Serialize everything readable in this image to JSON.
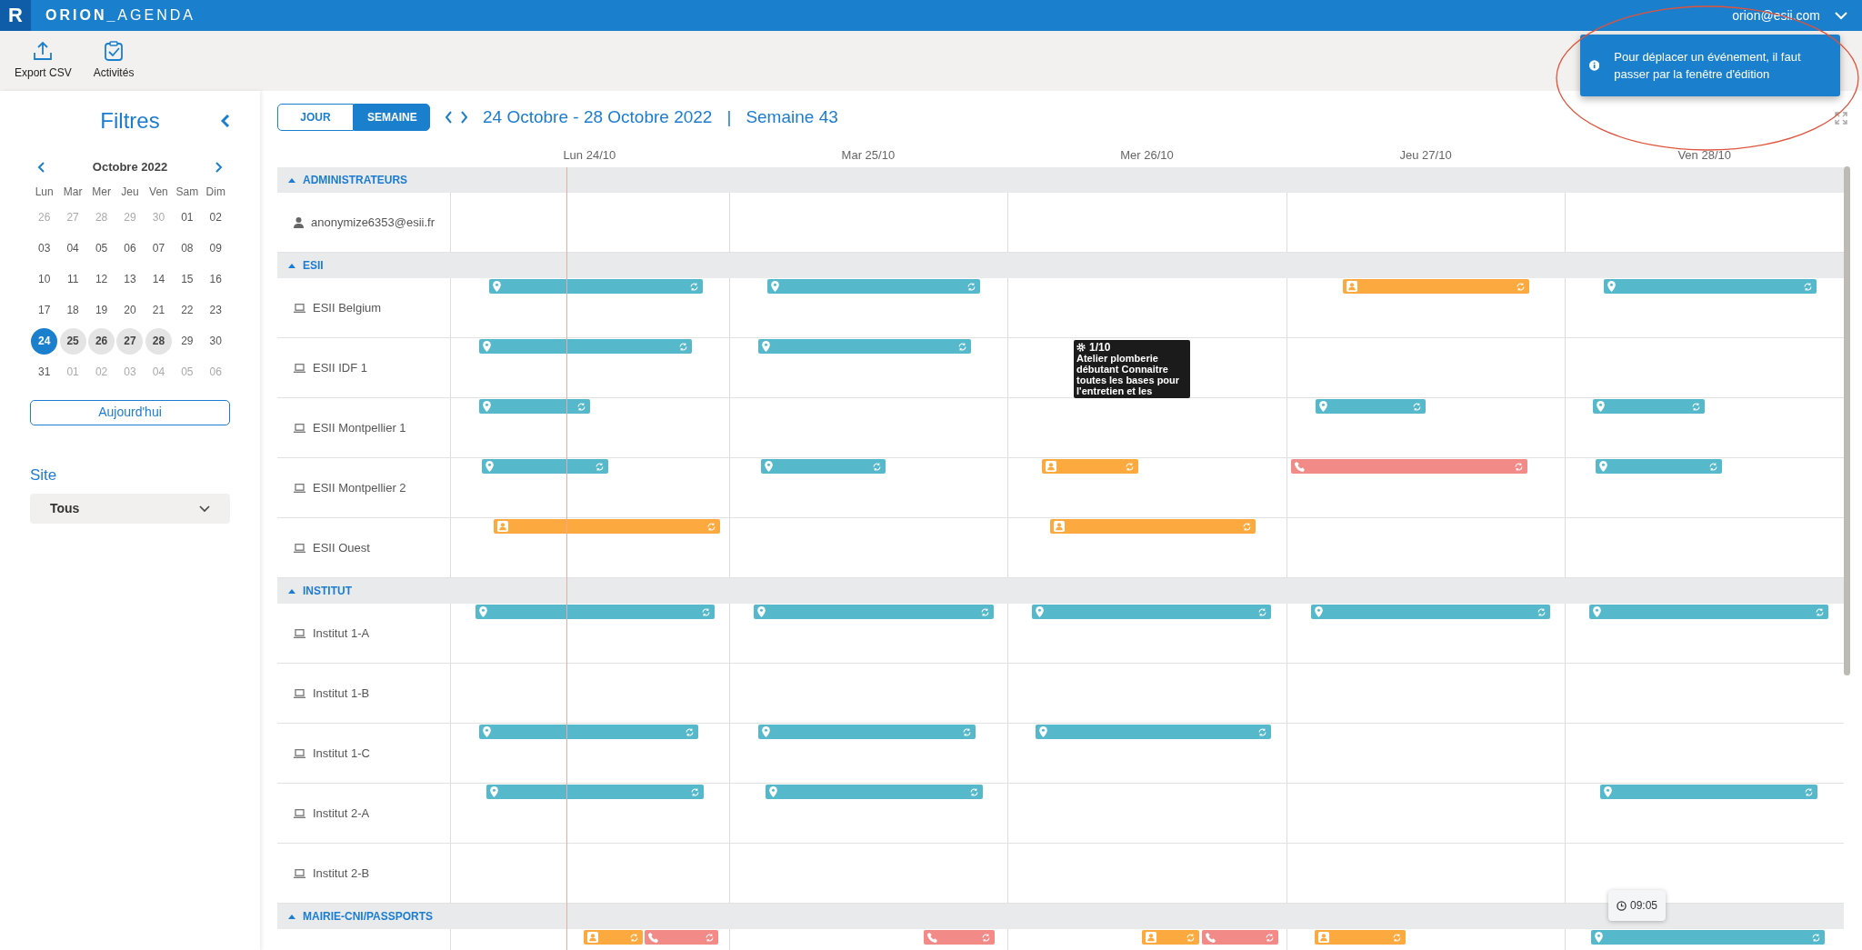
{
  "app": {
    "logo": "R",
    "title": "**ORION_**AGENDA",
    "user": "orion@esii.com"
  },
  "toolbar": [
    {
      "label": "Export CSV",
      "kind": "export"
    },
    {
      "label": "Activités",
      "kind": "activities"
    }
  ],
  "notification": {
    "text": "Pour déplacer un événement, il faut passer par la fenêtre d'édition"
  },
  "filters": {
    "title": "Filtres",
    "calendar": {
      "month": "Octobre 2022",
      "weekdays": [
        "Lun",
        "Mar",
        "Mer",
        "Jeu",
        "Ven",
        "Sam",
        "Dim"
      ],
      "weeks": [
        [
          {
            "label": "26",
            "other_month": true,
            "selected": false,
            "in_range": false
          },
          {
            "label": "27",
            "other_month": true,
            "selected": false,
            "in_range": false
          },
          {
            "label": "28",
            "other_month": true,
            "selected": false,
            "in_range": false
          },
          {
            "label": "29",
            "other_month": true,
            "selected": false,
            "in_range": false
          },
          {
            "label": "30",
            "other_month": true,
            "selected": false,
            "in_range": false
          },
          {
            "label": "01",
            "other_month": false,
            "selected": false,
            "in_range": false
          },
          {
            "label": "02",
            "other_month": false,
            "selected": false,
            "in_range": false
          }
        ],
        [
          {
            "label": "03",
            "other_month": false,
            "selected": false,
            "in_range": false
          },
          {
            "label": "04",
            "other_month": false,
            "selected": false,
            "in_range": false
          },
          {
            "label": "05",
            "other_month": false,
            "selected": false,
            "in_range": false
          },
          {
            "label": "06",
            "other_month": false,
            "selected": false,
            "in_range": false
          },
          {
            "label": "07",
            "other_month": false,
            "selected": false,
            "in_range": false
          },
          {
            "label": "08",
            "other_month": false,
            "selected": false,
            "in_range": false
          },
          {
            "label": "09",
            "other_month": false,
            "selected": false,
            "in_range": false
          }
        ],
        [
          {
            "label": "10",
            "other_month": false,
            "selected": false,
            "in_range": false
          },
          {
            "label": "11",
            "other_month": false,
            "selected": false,
            "in_range": false
          },
          {
            "label": "12",
            "other_month": false,
            "selected": false,
            "in_range": false
          },
          {
            "label": "13",
            "other_month": false,
            "selected": false,
            "in_range": false
          },
          {
            "label": "14",
            "other_month": false,
            "selected": false,
            "in_range": false
          },
          {
            "label": "15",
            "other_month": false,
            "selected": false,
            "in_range": false
          },
          {
            "label": "16",
            "other_month": false,
            "selected": false,
            "in_range": false
          }
        ],
        [
          {
            "label": "17",
            "other_month": false,
            "selected": false,
            "in_range": false
          },
          {
            "label": "18",
            "other_month": false,
            "selected": false,
            "in_range": false
          },
          {
            "label": "19",
            "other_month": false,
            "selected": false,
            "in_range": false
          },
          {
            "label": "20",
            "other_month": false,
            "selected": false,
            "in_range": false
          },
          {
            "label": "21",
            "other_month": false,
            "selected": false,
            "in_range": false
          },
          {
            "label": "22",
            "other_month": false,
            "selected": false,
            "in_range": false
          },
          {
            "label": "23",
            "other_month": false,
            "selected": false,
            "in_range": false
          }
        ],
        [
          {
            "label": "24",
            "other_month": false,
            "selected": true,
            "in_range": true
          },
          {
            "label": "25",
            "other_month": false,
            "selected": false,
            "in_range": true
          },
          {
            "label": "26",
            "other_month": false,
            "selected": false,
            "in_range": true
          },
          {
            "label": "27",
            "other_month": false,
            "selected": false,
            "in_range": true
          },
          {
            "label": "28",
            "other_month": false,
            "selected": false,
            "in_range": true
          },
          {
            "label": "29",
            "other_month": false,
            "selected": false,
            "in_range": false
          },
          {
            "label": "30",
            "other_month": false,
            "selected": false,
            "in_range": false
          }
        ],
        [
          {
            "label": "31",
            "other_month": false,
            "selected": false,
            "in_range": false
          },
          {
            "label": "01",
            "other_month": true,
            "selected": false,
            "in_range": false
          },
          {
            "label": "02",
            "other_month": true,
            "selected": false,
            "in_range": false
          },
          {
            "label": "03",
            "other_month": true,
            "selected": false,
            "in_range": false
          },
          {
            "label": "04",
            "other_month": true,
            "selected": false,
            "in_range": false
          },
          {
            "label": "05",
            "other_month": true,
            "selected": false,
            "in_range": false
          },
          {
            "label": "06",
            "other_month": true,
            "selected": false,
            "in_range": false
          }
        ]
      ]
    },
    "today_button": "Aujourd'hui",
    "site": {
      "label": "Site",
      "value": "Tous"
    }
  },
  "view_tabs": [
    {
      "label": "JOUR",
      "selected": false
    },
    {
      "label": "SEMAINE",
      "selected": true
    }
  ],
  "period": {
    "range": "24 Octobre - 28 Octobre 2022",
    "separator": "|",
    "week": "Semaine 43"
  },
  "days": [
    "Lun 24/10",
    "Mar 25/10",
    "Mer 26/10",
    "Jeu 27/10",
    "Ven 28/10"
  ],
  "groups": [
    {
      "name": "ADMINISTRATEURS",
      "expanded": true,
      "resources": [
        {
          "name": "anonymize6353@esii.fr",
          "kind": "user"
        }
      ]
    },
    {
      "name": "ESII",
      "expanded": true,
      "resources": [
        {
          "name": "ESII Belgium",
          "kind": "room",
          "cells": [
            {
              "kind": "busy",
              "events": [
                {
                  "kind": "location"
                }
              ]
            },
            {
              "kind": "busy",
              "events": [
                {
                  "kind": "location"
                }
              ]
            },
            {
              "kind": "free"
            },
            {
              "kind": "busy",
              "events": [
                {
                  "kind": "training"
                }
              ]
            },
            {
              "kind": "busy",
              "events": [
                {
                  "kind": "location"
                }
              ]
            }
          ]
        },
        {
          "name": "ESII IDF 1",
          "kind": "room",
          "cells": [
            {
              "kind": "busy",
              "events": [
                {
                  "kind": "location"
                }
              ]
            },
            {
              "kind": "busy",
              "events": [
                {
                  "kind": "location"
                }
              ]
            },
            {
              "kind": "free"
            },
            {
              "kind": "free"
            },
            {
              "kind": "free"
            }
          ]
        },
        {
          "name": "ESII Montpellier 1",
          "kind": "room",
          "cells": [
            {
              "kind": "busy",
              "events": [
                {
                  "kind": "location"
                }
              ]
            },
            {
              "kind": "free"
            },
            {
              "kind": "free"
            },
            {
              "kind": "busy",
              "events": [
                {
                  "kind": "location"
                }
              ]
            },
            {
              "kind": "busy",
              "events": [
                {
                  "kind": "location"
                }
              ]
            }
          ]
        },
        {
          "name": "ESII Montpellier 2",
          "kind": "room",
          "cells": [
            {
              "kind": "busy",
              "events": [
                {
                  "kind": "location"
                }
              ]
            },
            {
              "kind": "busy",
              "events": [
                {
                  "kind": "location"
                }
              ]
            },
            {
              "kind": "busy",
              "events": [
                {
                  "kind": "training"
                }
              ]
            },
            {
              "kind": "busy",
              "events": [
                {
                  "kind": "phone"
                }
              ]
            },
            {
              "kind": "busy",
              "events": [
                {
                  "kind": "location"
                }
              ]
            }
          ]
        },
        {
          "name": "ESII Ouest",
          "kind": "room",
          "cells": [
            {
              "kind": "busy",
              "events": [
                {
                  "kind": "training"
                }
              ]
            },
            {
              "kind": "free"
            },
            {
              "kind": "busy",
              "events": [
                {
                  "kind": "training"
                }
              ]
            },
            {
              "kind": "free"
            },
            {
              "kind": "free"
            }
          ]
        }
      ]
    },
    {
      "name": "INSTITUT",
      "expanded": true,
      "resources": [
        {
          "name": "Institut 1-A",
          "kind": "room",
          "cells": [
            {
              "kind": "busy",
              "events": [
                {
                  "kind": "location"
                }
              ]
            },
            {
              "kind": "busy",
              "events": [
                {
                  "kind": "location"
                }
              ]
            },
            {
              "kind": "busy",
              "events": [
                {
                  "kind": "location"
                }
              ]
            },
            {
              "kind": "busy",
              "events": [
                {
                  "kind": "location"
                }
              ]
            },
            {
              "kind": "busy",
              "events": [
                {
                  "kind": "location"
                }
              ]
            }
          ]
        },
        {
          "name": "Institut 1-B",
          "kind": "room"
        },
        {
          "name": "Institut 1-C",
          "kind": "room",
          "cells": [
            {
              "kind": "busy",
              "events": [
                {
                  "kind": "location"
                }
              ]
            },
            {
              "kind": "busy",
              "events": [
                {
                  "kind": "location"
                }
              ]
            },
            {
              "kind": "busy",
              "events": [
                {
                  "kind": "location"
                }
              ]
            },
            {
              "kind": "free"
            },
            {
              "kind": "free"
            }
          ]
        },
        {
          "name": "Institut 2-A",
          "kind": "room",
          "cells": [
            {
              "kind": "busy",
              "events": [
                {
                  "kind": "location"
                }
              ]
            },
            {
              "kind": "busy",
              "events": [
                {
                  "kind": "location"
                }
              ]
            },
            {
              "kind": "free"
            },
            {
              "kind": "free"
            },
            {
              "kind": "busy",
              "events": [
                {
                  "kind": "location"
                }
              ]
            }
          ]
        },
        {
          "name": "Institut 2-B",
          "kind": "room"
        }
      ]
    },
    {
      "name": "MAIRIE-CNI/PASSPORTS",
      "expanded": true,
      "resources": [
        {
          "cells": [
            {
              "kind": "busy",
              "events": [
                {
                  "kind": "training"
                },
                {
                  "kind": "phone"
                }
              ]
            },
            {
              "kind": "busy",
              "events": [
                {
                  "kind": "phone"
                }
              ]
            },
            {
              "kind": "busy",
              "events": [
                {
                  "kind": "training"
                },
                {
                  "kind": "phone"
                }
              ]
            },
            {
              "kind": "busy",
              "events": [
                {
                  "kind": "training"
                }
              ]
            },
            {
              "kind": "busy",
              "events": [
                {
                  "kind": "location"
                }
              ]
            }
          ]
        }
      ]
    }
  ],
  "tooltip": {
    "count": "1/10",
    "text": "Atelier plomberie débutant Connaitre toutes les bases pour l'entretien et les"
  },
  "time_bubble": "09:05"
}
